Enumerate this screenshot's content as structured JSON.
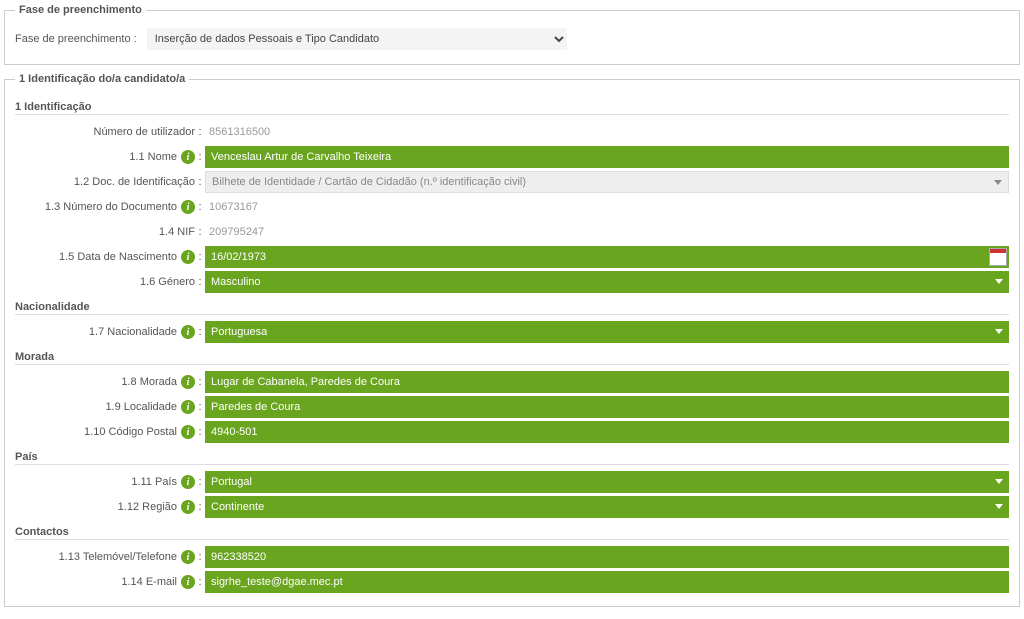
{
  "phase": {
    "fieldset_legend": "Fase de preenchimento",
    "label": "Fase de preenchimento :",
    "value": "Inserção de dados Pessoais e Tipo Candidato"
  },
  "section1": {
    "legend": "1 Identificação do/a candidato/a",
    "ident_header": "1 Identificação",
    "user_number_label": "Número de utilizador",
    "user_number": "8561316500",
    "f1_1_label": "1.1 Nome",
    "f1_1": "Venceslau Artur de Carvalho Teixeira",
    "f1_2_label": "1.2 Doc. de Identificação",
    "f1_2": "Bilhete de Identidade / Cartão de Cidadão (n.º identificação civil)",
    "f1_3_label": "1.3 Número do Documento",
    "f1_3": "10673167",
    "f1_4_label": "1.4 NIF",
    "f1_4": "209795247",
    "f1_5_label": "1.5 Data de Nascimento",
    "f1_5": "16/02/1973",
    "f1_6_label": "1.6 Género",
    "f1_6": "Masculino",
    "nac_header": "Nacionalidade",
    "f1_7_label": "1.7 Nacionalidade",
    "f1_7": "Portuguesa",
    "mor_header": "Morada",
    "f1_8_label": "1.8 Morada",
    "f1_8": "Lugar de Cabanela, Paredes de Coura",
    "f1_9_label": "1.9 Localidade",
    "f1_9": "Paredes de Coura",
    "f1_10_label": "1.10 Código Postal",
    "f1_10": "4940-501",
    "pais_header": "País",
    "f1_11_label": "1.11 País",
    "f1_11": "Portugal",
    "f1_12_label": "1.12 Região",
    "f1_12": "Continente",
    "cont_header": "Contactos",
    "f1_13_label": "1.13 Telemóvel/Telefone",
    "f1_13": "962338520",
    "f1_14_label": "1.14 E-mail",
    "f1_14": "sigrhe_teste@dgae.mec.pt"
  }
}
